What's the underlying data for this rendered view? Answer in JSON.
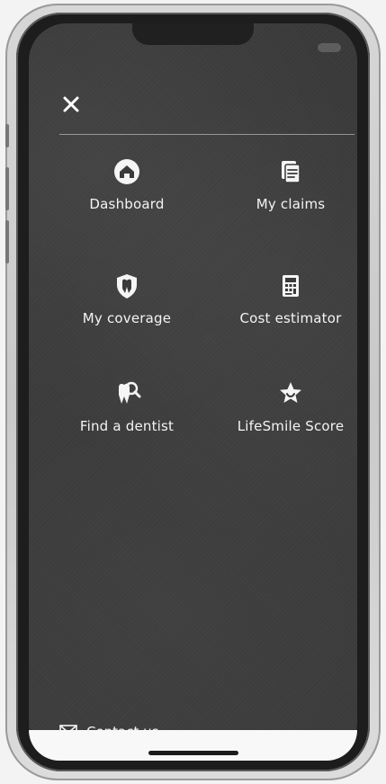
{
  "menu": {
    "items": [
      {
        "label": "Dashboard",
        "icon": "home-icon"
      },
      {
        "label": "My claims",
        "icon": "claims-icon"
      },
      {
        "label": "My coverage",
        "icon": "coverage-shield-icon"
      },
      {
        "label": "Cost estimator",
        "icon": "calculator-icon"
      },
      {
        "label": "Find a dentist",
        "icon": "dentist-search-icon"
      },
      {
        "label": "LifeSmile Score",
        "icon": "star-score-icon"
      }
    ]
  },
  "footer": {
    "contact_label": "Contact us",
    "contact_icon": "mail-icon"
  },
  "colors": {
    "screen_background": "#3a3a3a",
    "text": "#f4f4f4",
    "divider": "#bfbfbf",
    "frame": "#d3d3d3"
  }
}
